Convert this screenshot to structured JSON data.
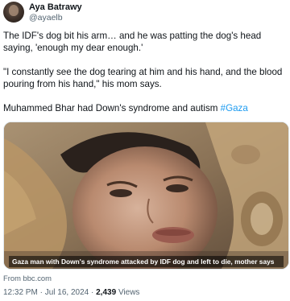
{
  "author": {
    "display_name": "Aya Batrawy",
    "handle": "@ayaelb",
    "more_icon": "more-icon"
  },
  "tweet": {
    "para1": "The IDF's dog bit his arm… and he was patting the dog's head saying, 'enough my dear enough.'",
    "para2": "\"I constantly see the dog tearing at him and his hand, and the blood pouring from his hand,\" his mom says.",
    "para3_text": "Muhammed Bhar had Down's syndrome and autism ",
    "para3_hashtag": "#Gaza"
  },
  "media": {
    "caption": "Gaza man with Down's syndrome attacked by IDF dog and left to die, mother says",
    "source": "From bbc.com"
  },
  "meta": {
    "time": "12:32 PM",
    "separator": "·",
    "date": "Jul 16, 2024",
    "views_count": "2,439",
    "views_label": "Views"
  },
  "colors": {
    "hashtag": "#1d9bf0",
    "secondary_text": "#536471",
    "primary_text": "#0f1419"
  }
}
